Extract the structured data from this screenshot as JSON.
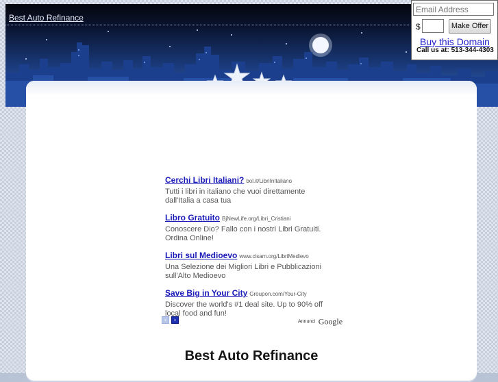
{
  "header": {
    "site_link": "Best Auto Refinance"
  },
  "offer_widget": {
    "email_placeholder": "Email Address",
    "currency_symbol": "$",
    "make_offer_label": "Make Offer",
    "buy_link": "Buy this Domain",
    "call_text": "Call us at: 513-344-4303"
  },
  "ads": {
    "items": [
      {
        "title": "Cerchi Libri Italiani?",
        "url": "bol.it/LibriInItaliano",
        "desc": "Tutti i libri in italiano che vuoi direttamente dall'Italia a casa tua"
      },
      {
        "title": "Libro Gratuito",
        "url": "BjNewLife.org/Libri_Cristiani",
        "desc": "Conoscere Dio? Fallo con i nostri Libri Gratuiti. Ordina Online!"
      },
      {
        "title": "Libri sul Medioevo",
        "url": "www.cisam.org/LibriMedievo",
        "desc": "Una Selezione dei Migliori Libri e Pubblicazioni sull'Alto Medioevo"
      },
      {
        "title": "Save Big in Your City",
        "url": "Groupon.com/Your-City",
        "desc": "Discover the world's #1 deal site. Up to 90% off local food and fun!"
      }
    ],
    "prev_icon": "chevron-left-icon",
    "next_icon": "chevron-right-icon",
    "prev_glyph": "‹",
    "next_glyph": "›",
    "by_label": "Annunci",
    "by_brand": "Google"
  },
  "main": {
    "title": "Best Auto Refinance"
  },
  "colors": {
    "link_blue": "#1a1ab8",
    "sky_top": "#05070d",
    "sky_bottom": "#3b6bc0"
  }
}
